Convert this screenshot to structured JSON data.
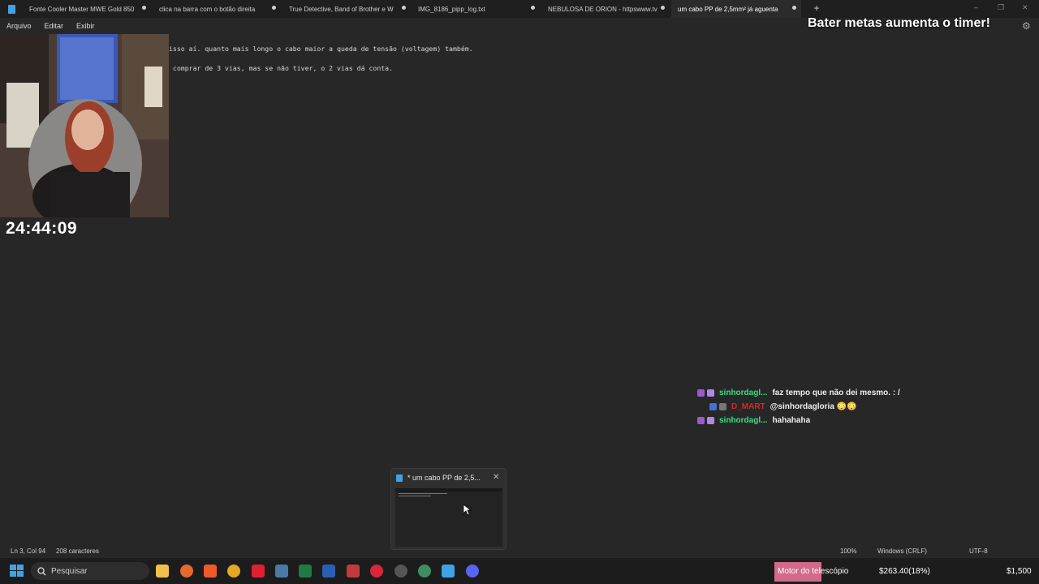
{
  "tabs": [
    {
      "label": "Fonte Cooler Master MWE Gold 850"
    },
    {
      "label": "clica na barra com o botão direita"
    },
    {
      "label": "True Detective, Band of Brother e W"
    },
    {
      "label": "IMG_8186_pipp_log.txt"
    },
    {
      "label": "NEBULOSA DE ORION - httpswww.tv"
    },
    {
      "label": "um cabo PP de 2,5mm² já aguenta"
    }
  ],
  "overlay": {
    "title": "Bater metas aumenta o timer!"
  },
  "menu": {
    "arquivo": "Arquivo",
    "editar": "Editar",
    "exibir": "Exibir"
  },
  "timer": "24:44:09",
  "editor": {
    "line1": "isso aí. quanto mais longo o cabo maior a queda de tensão (voltagem) também.",
    "line2": " comprar de 3 vias, mas se não tiver, o 2 vias dá conta."
  },
  "chat": [
    {
      "user": "sinhordagl...",
      "message": "faz tempo que não dei mesmo. : /",
      "color": "#3ddc84"
    },
    {
      "user": "D_MART",
      "message": "@sinhordagloria 😳😳",
      "color": "#d62828"
    },
    {
      "user": "sinhordagl...",
      "message": "hahahaha",
      "color": "#3ddc84"
    }
  ],
  "thumbnail": {
    "title": "* um cabo PP de 2,5..."
  },
  "status": {
    "position": "Ln 3, Col 94",
    "chars": "208 caracteres",
    "zoom": "100%",
    "eol": "Windows (CRLF)",
    "encoding": "UTF-8"
  },
  "taskbar": {
    "search_placeholder": "Pesquisar",
    "motor_label": "Motor do telescópio",
    "money": "$263.40(18%)",
    "goal": "$1,500"
  }
}
